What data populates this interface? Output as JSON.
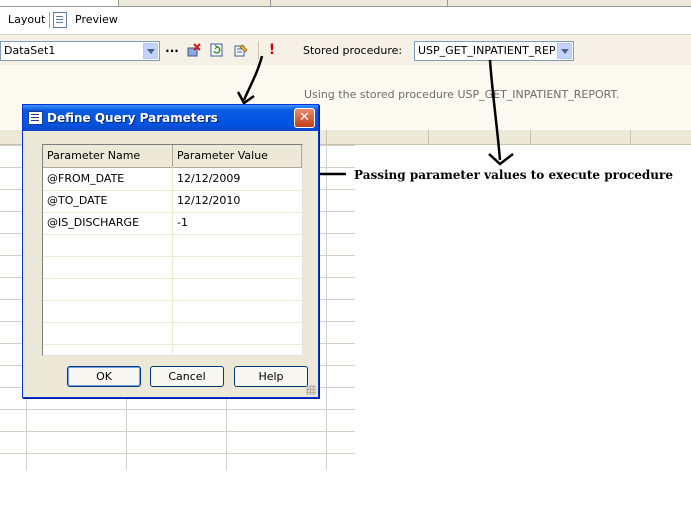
{
  "view_tabs": {
    "layout": "Layout",
    "preview": "Preview"
  },
  "toolbar": {
    "dataset": "DataSet1",
    "more": "...",
    "stored_procedure_label": "Stored procedure:",
    "stored_procedure_value": "USP_GET_INPATIENT_REPOI"
  },
  "info": {
    "text": "Using the stored procedure USP_GET_INPATIENT_REPORT."
  },
  "dialog": {
    "title": "Define Query Parameters",
    "close": "✕",
    "columns": [
      "Parameter Name",
      "Parameter Value"
    ],
    "rows": [
      {
        "name": "@FROM_DATE",
        "value": "12/12/2009"
      },
      {
        "name": "@TO_DATE",
        "value": "12/12/2010"
      },
      {
        "name": "@IS_DISCHARGE",
        "value": "-1"
      }
    ],
    "ok": "OK",
    "cancel": "Cancel",
    "help": "Help"
  },
  "annotation": {
    "text": "Passing parameter values to execute procedure"
  },
  "colors": {
    "titlebar": "#0054e3",
    "window_bg": "#ece9d8",
    "run_icon": "#cc0000"
  }
}
